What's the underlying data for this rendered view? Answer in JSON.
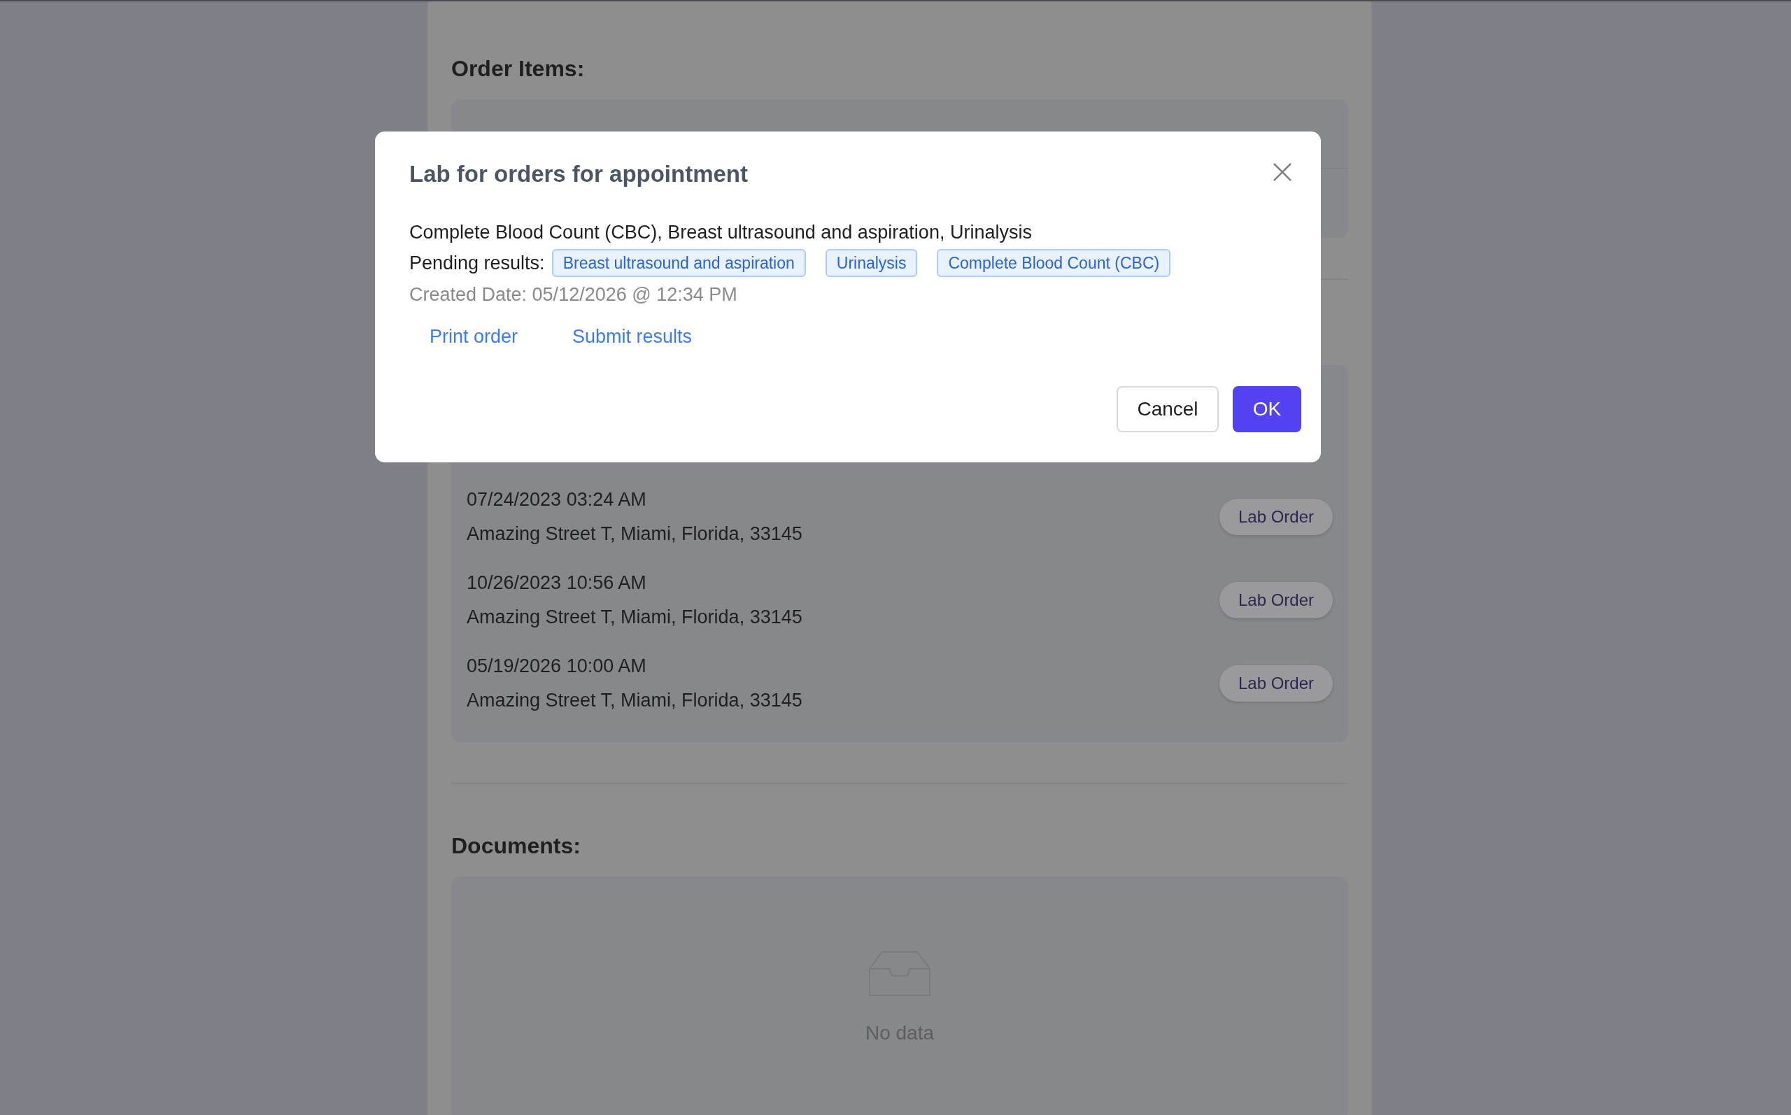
{
  "order_items": {
    "heading": "Order Items:"
  },
  "appointments": [
    {
      "date": "07/24/2023 03:24 AM",
      "address": "Amazing Street T, Miami, Florida, 33145",
      "action": "Lab Order"
    },
    {
      "date": "10/26/2023 10:56 AM",
      "address": "Amazing Street T, Miami, Florida, 33145",
      "action": "Lab Order"
    },
    {
      "date": "05/19/2026 10:00 AM",
      "address": "Amazing Street T, Miami, Florida, 33145",
      "action": "Lab Order"
    }
  ],
  "documents": {
    "heading": "Documents:",
    "empty_text": "No data"
  },
  "modal": {
    "title": "Lab for orders for appointment",
    "tests": "Complete Blood Count (CBC), Breast ultrasound and aspiration, Urinalysis",
    "pending_label": "Pending results:",
    "pending_tags": [
      "Breast ultrasound and aspiration",
      "Urinalysis",
      "Complete Blood Count (CBC)"
    ],
    "created": "Created Date: 05/12/2026 @ 12:34 PM",
    "links": [
      "Print order",
      "Submit results"
    ],
    "buttons": [
      {
        "label": "Cancel",
        "kind": "default"
      },
      {
        "label": "OK",
        "kind": "primary"
      }
    ]
  }
}
